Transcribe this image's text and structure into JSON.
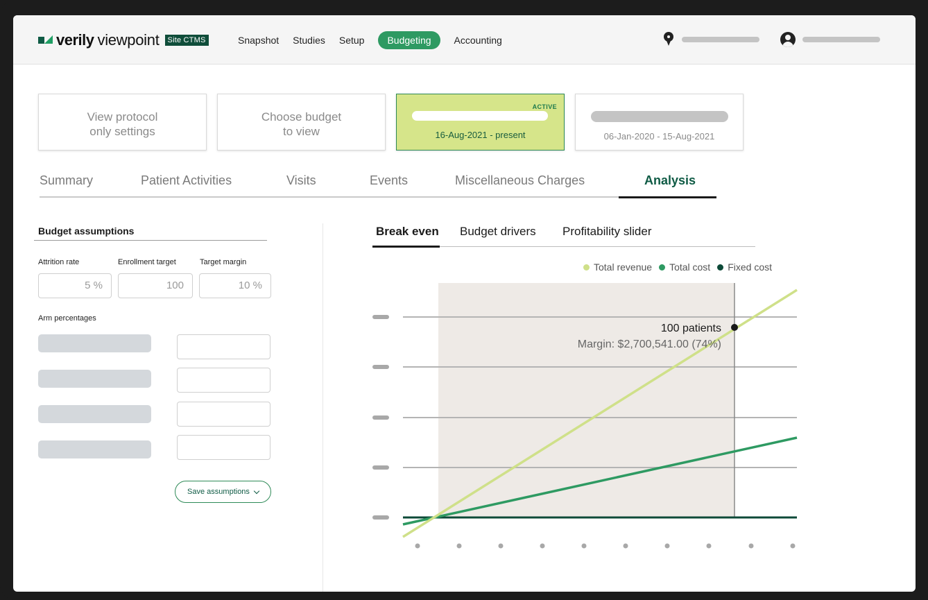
{
  "header": {
    "logo_bold": "verily",
    "logo_light": "viewpoint",
    "logo_badge": "Site CTMS",
    "nav": [
      "Snapshot",
      "Studies",
      "Setup",
      "Budgeting",
      "Accounting"
    ],
    "active_nav": "Budgeting"
  },
  "budget_cards": {
    "protocol_line1": "View protocol",
    "protocol_line2": "only settings",
    "choose_line1": "Choose budget",
    "choose_line2": "to view",
    "active_badge": "ACTIVE",
    "active_range": "16-Aug-2021 - present",
    "past_range": "06-Jan-2020 - 15-Aug-2021"
  },
  "tabs": [
    "Summary",
    "Patient Activities",
    "Visits",
    "Events",
    "Miscellaneous Charges",
    "Analysis"
  ],
  "active_tab": "Analysis",
  "assumptions": {
    "title": "Budget assumptions",
    "attrition_label": "Attrition rate",
    "attrition_value": "5 %",
    "enrollment_label": "Enrollment target",
    "enrollment_value": "100",
    "margin_label": "Target margin",
    "margin_value": "10 %",
    "arm_label": "Arm percentages",
    "save_label": "Save assumptions"
  },
  "analysis_tabs": [
    "Break even",
    "Budget drivers",
    "Profitability slider"
  ],
  "active_analysis_tab": "Break even",
  "colors": {
    "brand_dark": "#0f5b45",
    "brand_green": "#2e9a62",
    "revenue": "#cfe089",
    "total_cost": "#2e9a62",
    "fixed_cost": "#0d4a38",
    "shade": "#eeeae6"
  },
  "chart_data": {
    "type": "line",
    "legend": [
      "Total revenue",
      "Total cost",
      "Fixed cost"
    ],
    "legend_position": "top-right",
    "grid": true,
    "annotation": {
      "title": "100 patients",
      "subtitle": "Margin: $2,700,541.00 (74%)"
    }
  }
}
